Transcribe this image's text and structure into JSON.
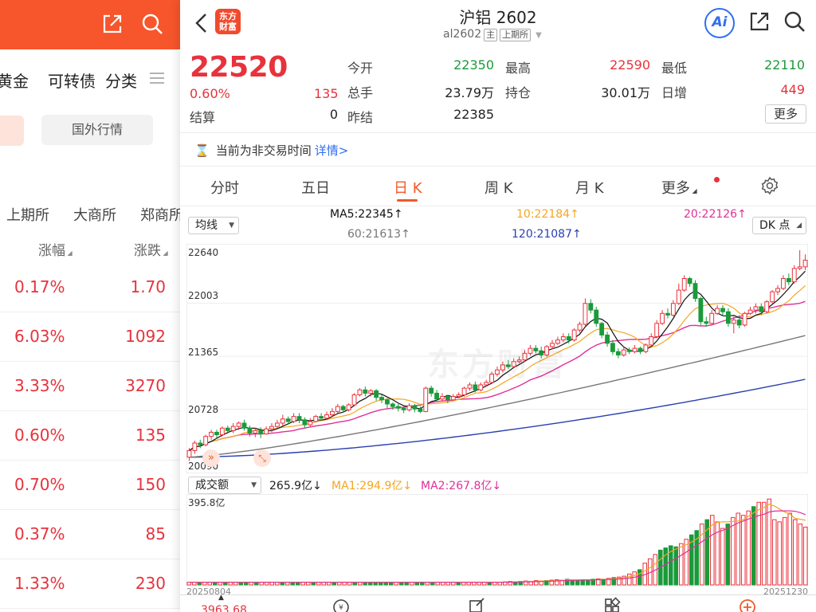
{
  "left": {
    "nav": [
      "黄金",
      "可转债",
      "分类"
    ],
    "menu_icon": "menu-icon",
    "pill_label": "国外行情",
    "exchanges": [
      "上期所",
      "大商所",
      "郑商所"
    ],
    "headers": {
      "pct": "涨幅",
      "chg": "涨跌"
    },
    "rows": [
      {
        "pct": "0.17%",
        "chg": "1.70"
      },
      {
        "pct": "6.03%",
        "chg": "1092"
      },
      {
        "pct": "3.33%",
        "chg": "3270"
      },
      {
        "pct": "0.60%",
        "chg": "135"
      },
      {
        "pct": "0.70%",
        "chg": "150"
      },
      {
        "pct": "0.37%",
        "chg": "85"
      },
      {
        "pct": "1.33%",
        "chg": "230"
      }
    ]
  },
  "header": {
    "logo_text_1": "东方",
    "logo_text_2": "财富",
    "title": "沪铝 2602",
    "code": "al2602",
    "tag_main": "主",
    "tag_exchange": "上期所",
    "ai_label": "Ai"
  },
  "quote": {
    "price": "22520",
    "pct": "0.60%",
    "chg": "135",
    "settle_label": "结算",
    "settle": "0",
    "open_label": "今开",
    "open": "22350",
    "high_label": "最高",
    "high": "22590",
    "low_label": "最低",
    "low": "22110",
    "vol_label": "总手",
    "vol": "23.79万",
    "oi_label": "持仓",
    "oi": "30.01万",
    "oi_chg_label": "日增",
    "oi_chg": "449",
    "prev_label": "昨结",
    "prev": "22385",
    "more": "更多"
  },
  "notice": {
    "text": "当前为非交易时间",
    "link": "详情>"
  },
  "tabs": [
    "分时",
    "五日",
    "日 K",
    "周 K",
    "月 K",
    "更多"
  ],
  "active_tab": 2,
  "indicators": {
    "select": "均线",
    "dk": "DK 点",
    "ma5": "MA5:22345↑",
    "ma10": "10:22184↑",
    "ma20": "20:22126↑",
    "ma60": "60:21613↑",
    "ma120": "120:21087↑"
  },
  "price_axis": [
    "22640",
    "22003",
    "21365",
    "20728",
    "20090"
  ],
  "volume": {
    "select": "成交额",
    "value": "265.9亿↓",
    "ma1": "MA1:294.9亿↓",
    "ma2": "MA2:267.8亿↓",
    "max_label": "395.8亿"
  },
  "dates": {
    "start": "20250804",
    "end": "20251230"
  },
  "index_value": "3963.68",
  "colors": {
    "up": "#e8323c",
    "down": "#1a9a3a",
    "accent": "#f05a28",
    "ma5": "#111111",
    "ma10": "#f5a623",
    "ma20": "#e0309a",
    "ma60": "#777777",
    "ma120": "#2a3fb0"
  },
  "chart_data": {
    "type": "candlestick",
    "y_range": [
      20090,
      22640
    ],
    "candles": [
      [
        20150,
        20230,
        20100,
        20260
      ],
      [
        20230,
        20320,
        20190,
        20350
      ],
      [
        20320,
        20300,
        20260,
        20360
      ],
      [
        20300,
        20400,
        20280,
        20420
      ],
      [
        20400,
        20450,
        20360,
        20480
      ],
      [
        20450,
        20420,
        20380,
        20480
      ],
      [
        20420,
        20500,
        20400,
        20520
      ],
      [
        20500,
        20470,
        20430,
        20530
      ],
      [
        20470,
        20520,
        20440,
        20560
      ],
      [
        20520,
        20560,
        20480,
        20580
      ],
      [
        20560,
        20500,
        20470,
        20600
      ],
      [
        20500,
        20440,
        20400,
        20530
      ],
      [
        20440,
        20470,
        20390,
        20500
      ],
      [
        20470,
        20430,
        20380,
        20510
      ],
      [
        20430,
        20490,
        20420,
        20520
      ],
      [
        20490,
        20520,
        20450,
        20560
      ],
      [
        20520,
        20560,
        20500,
        20600
      ],
      [
        20560,
        20610,
        20530,
        20660
      ],
      [
        20610,
        20580,
        20540,
        20640
      ],
      [
        20580,
        20640,
        20560,
        20680
      ],
      [
        20640,
        20600,
        20560,
        20680
      ],
      [
        20600,
        20540,
        20500,
        20630
      ],
      [
        20540,
        20580,
        20510,
        20620
      ],
      [
        20580,
        20640,
        20570,
        20660
      ],
      [
        20640,
        20620,
        20590,
        20680
      ],
      [
        20620,
        20660,
        20600,
        20700
      ],
      [
        20660,
        20700,
        20630,
        20740
      ],
      [
        20700,
        20760,
        20680,
        20790
      ],
      [
        20760,
        20720,
        20690,
        20780
      ],
      [
        20720,
        20780,
        20700,
        20800
      ],
      [
        20780,
        20900,
        20760,
        20920
      ],
      [
        20900,
        20960,
        20880,
        20980
      ],
      [
        20960,
        20920,
        20880,
        21000
      ],
      [
        20920,
        20950,
        20880,
        20970
      ],
      [
        20950,
        20870,
        20830,
        20970
      ],
      [
        20870,
        20840,
        20800,
        20900
      ],
      [
        20840,
        20790,
        20740,
        20860
      ],
      [
        20790,
        20760,
        20720,
        20810
      ],
      [
        20760,
        20740,
        20700,
        20790
      ],
      [
        20740,
        20720,
        20680,
        20760
      ],
      [
        20720,
        20770,
        20700,
        20800
      ],
      [
        20770,
        20730,
        20690,
        20790
      ],
      [
        20730,
        20700,
        20680,
        20760
      ],
      [
        20700,
        20980,
        20690,
        21000
      ],
      [
        20980,
        20920,
        20880,
        21010
      ],
      [
        20920,
        20850,
        20820,
        20960
      ],
      [
        20850,
        20880,
        20820,
        20920
      ],
      [
        20880,
        20840,
        20800,
        20900
      ],
      [
        20840,
        20880,
        20830,
        20910
      ],
      [
        20880,
        20900,
        20860,
        20930
      ],
      [
        20900,
        20980,
        20880,
        21000
      ],
      [
        20980,
        21020,
        20950,
        21050
      ],
      [
        21020,
        20960,
        20930,
        21060
      ],
      [
        20960,
        21020,
        20940,
        21050
      ],
      [
        21020,
        21050,
        21000,
        21080
      ],
      [
        21050,
        21150,
        21030,
        21180
      ],
      [
        21150,
        21200,
        21120,
        21240
      ],
      [
        21200,
        21260,
        21170,
        21300
      ],
      [
        21260,
        21240,
        21210,
        21320
      ],
      [
        21240,
        21300,
        21220,
        21340
      ],
      [
        21300,
        21320,
        21280,
        21360
      ],
      [
        21320,
        21400,
        21300,
        21440
      ],
      [
        21400,
        21460,
        21370,
        21500
      ],
      [
        21460,
        21430,
        21400,
        21500
      ],
      [
        21430,
        21380,
        21340,
        21480
      ],
      [
        21380,
        21480,
        21360,
        21500
      ],
      [
        21480,
        21520,
        21450,
        21560
      ],
      [
        21520,
        21560,
        21500,
        21600
      ],
      [
        21560,
        21600,
        21530,
        21640
      ],
      [
        21600,
        21560,
        21520,
        21640
      ],
      [
        21560,
        21680,
        21540,
        21700
      ],
      [
        21680,
        21750,
        21650,
        21780
      ],
      [
        21750,
        22000,
        21720,
        22060
      ],
      [
        22000,
        21920,
        21880,
        22050
      ],
      [
        21920,
        21760,
        21720,
        21960
      ],
      [
        21760,
        21620,
        21580,
        21780
      ],
      [
        21620,
        21520,
        21480,
        21660
      ],
      [
        21520,
        21420,
        21380,
        21560
      ],
      [
        21420,
        21380,
        21340,
        21460
      ],
      [
        21380,
        21440,
        21360,
        21480
      ],
      [
        21440,
        21420,
        21390,
        21470
      ],
      [
        21420,
        21460,
        21400,
        21500
      ],
      [
        21460,
        21420,
        21390,
        21480
      ],
      [
        21420,
        21500,
        21400,
        21520
      ],
      [
        21500,
        21600,
        21480,
        21640
      ],
      [
        21600,
        21760,
        21580,
        21800
      ],
      [
        21760,
        21880,
        21740,
        21920
      ],
      [
        21880,
        21860,
        21820,
        21940
      ],
      [
        21860,
        22000,
        21840,
        22040
      ],
      [
        22000,
        22160,
        21980,
        22240
      ],
      [
        22160,
        22300,
        22140,
        22340
      ],
      [
        22300,
        22240,
        22200,
        22320
      ],
      [
        22240,
        22060,
        22020,
        22280
      ],
      [
        22060,
        21780,
        21740,
        22080
      ],
      [
        21780,
        21760,
        21720,
        21840
      ],
      [
        21760,
        21880,
        21740,
        21920
      ],
      [
        21880,
        21940,
        21860,
        21980
      ],
      [
        21940,
        21900,
        21860,
        21980
      ],
      [
        21900,
        21760,
        21720,
        21940
      ],
      [
        21760,
        21800,
        21640,
        21840
      ],
      [
        21800,
        21740,
        21700,
        21860
      ],
      [
        21740,
        21880,
        21720,
        21900
      ],
      [
        21880,
        21920,
        21860,
        21960
      ],
      [
        21920,
        21960,
        21880,
        22000
      ],
      [
        21960,
        21900,
        21860,
        22000
      ],
      [
        21900,
        22020,
        21880,
        22040
      ],
      [
        22020,
        22140,
        22000,
        22160
      ],
      [
        22140,
        22180,
        22100,
        22220
      ],
      [
        22180,
        22300,
        22160,
        22340
      ],
      [
        22300,
        22260,
        22220,
        22360
      ],
      [
        22260,
        22420,
        22240,
        22460
      ],
      [
        22420,
        22440,
        22400,
        22640
      ],
      [
        22440,
        22520,
        22400,
        22590
      ]
    ],
    "volumes": [
      12,
      12,
      12,
      12,
      12,
      12,
      12,
      12,
      12,
      12,
      12,
      12,
      12,
      12,
      12,
      12,
      12,
      12,
      12,
      12,
      12,
      12,
      12,
      12,
      12,
      12,
      12,
      12,
      12,
      12,
      12,
      12,
      12,
      12,
      12,
      12,
      12,
      12,
      12,
      12,
      12,
      12,
      12,
      12,
      12,
      12,
      12,
      12,
      12,
      12,
      12,
      12,
      12,
      12,
      12,
      12,
      12,
      12,
      12,
      12,
      12,
      14,
      16,
      14,
      16,
      18,
      16,
      20,
      18,
      20,
      22,
      24,
      22,
      26,
      24,
      22,
      24,
      22,
      26,
      28,
      26,
      30,
      34,
      36,
      40,
      50,
      60,
      70,
      100,
      120,
      140,
      160,
      170,
      180,
      175,
      190,
      210,
      230,
      250,
      280,
      300,
      320,
      290,
      260,
      280,
      310,
      330,
      320,
      340,
      360,
      380,
      380,
      395,
      300,
      290,
      310,
      330,
      300,
      280,
      265.9
    ]
  }
}
